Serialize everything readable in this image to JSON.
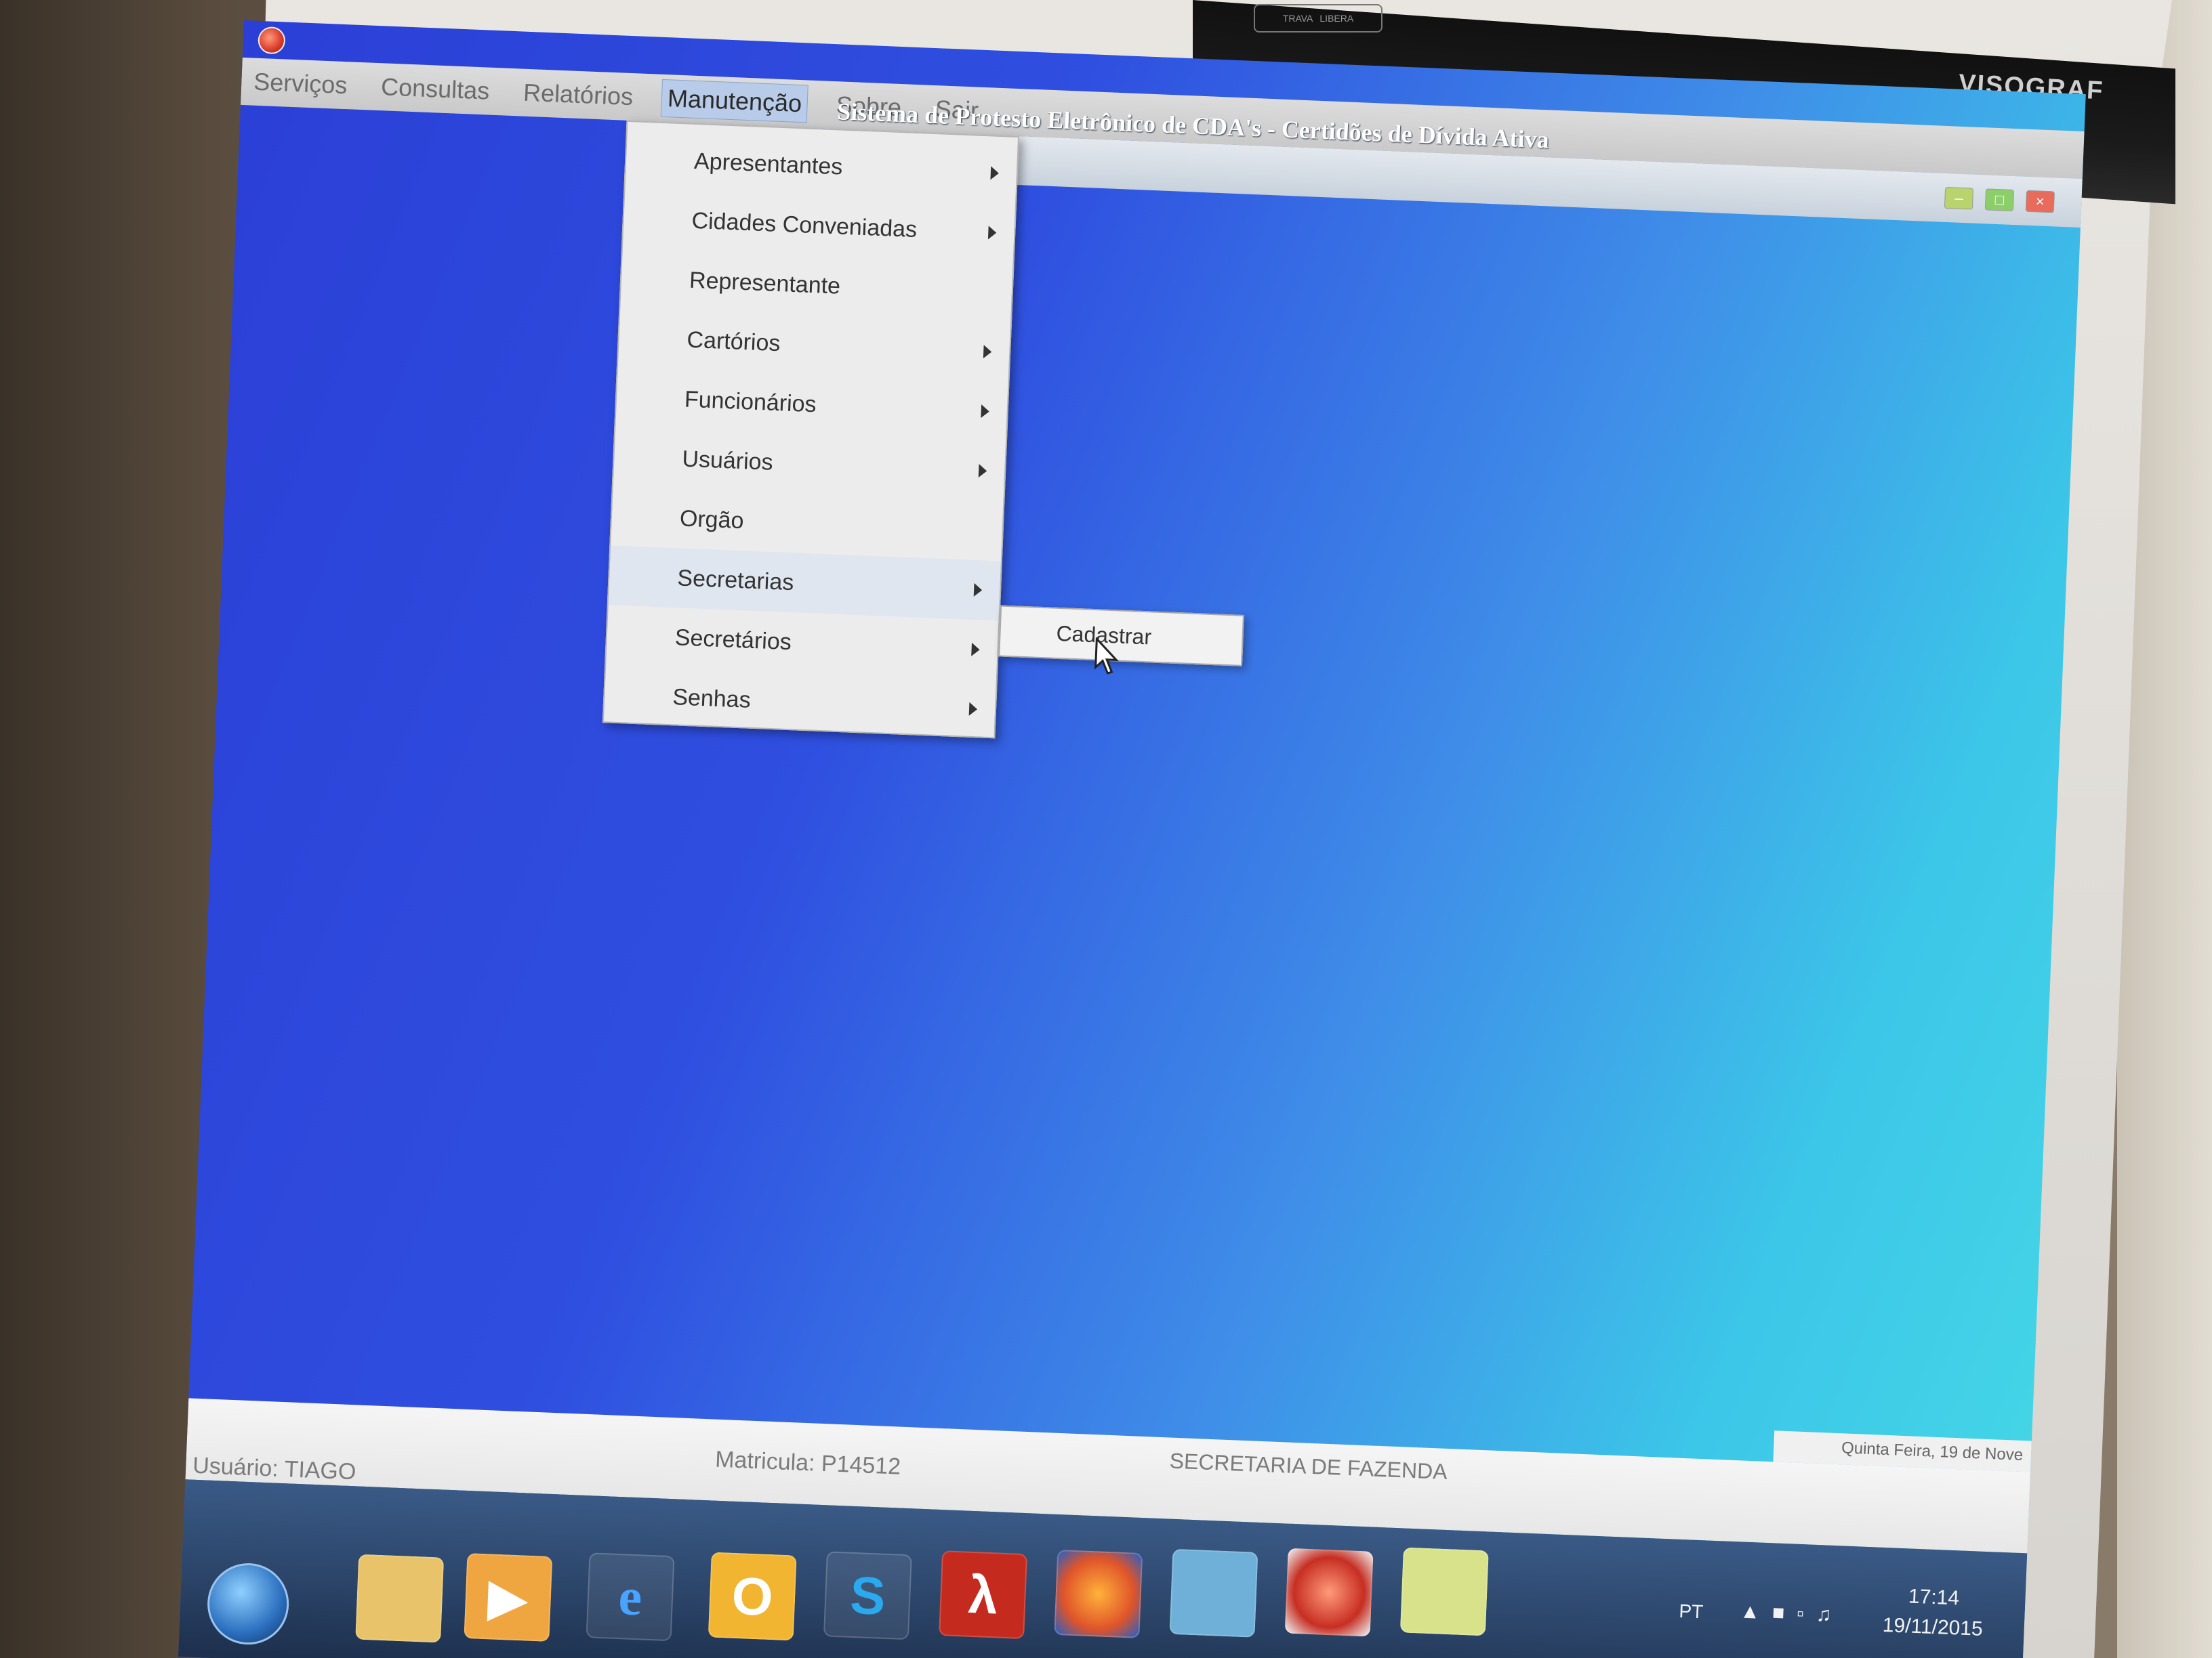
{
  "monitor_brand": "VISOGRAF",
  "top_plate": [
    "TRAVA",
    "LIBERA"
  ],
  "app": {
    "title": "Sistema de Protesto Eletrônico de CDA's - Certidões de Dívida Ativa"
  },
  "menubar": {
    "items": [
      "Serviços",
      "Consultas",
      "Relatórios",
      "Manutenção",
      "Sobre",
      "Sair"
    ],
    "active": "Manutenção"
  },
  "dropdown": {
    "items": [
      {
        "label": "Apresentantes",
        "has_submenu": true
      },
      {
        "label": "Cidades Conveniadas",
        "has_submenu": true
      },
      {
        "label": "Representante",
        "has_submenu": false
      },
      {
        "label": "Cartórios",
        "has_submenu": true
      },
      {
        "label": "Funcionários",
        "has_submenu": true
      },
      {
        "label": "Usuários",
        "has_submenu": true
      },
      {
        "label": "Orgão",
        "has_submenu": false
      },
      {
        "label": "Secretarias",
        "has_submenu": true
      },
      {
        "label": "Secretários",
        "has_submenu": true
      },
      {
        "label": "Senhas",
        "has_submenu": true
      }
    ],
    "highlighted": "Secretarias"
  },
  "submenu": {
    "items": [
      "Cadastrar"
    ]
  },
  "status": {
    "date_text": "Quinta Feira, 19 de Nove",
    "user": "Usuário: TIAGO",
    "matricula": "Matricula: P14512",
    "secretaria": "SECRETARIA DE FAZENDA"
  },
  "taskbar": {
    "icons": [
      "windows-explorer-folder",
      "media-player",
      "internet-explorer",
      "outlook",
      "skype",
      "adobe-reader",
      "firefox",
      "remote-desktop",
      "protesto-app",
      "sticky-notes"
    ],
    "language": "PT",
    "time": "17:14",
    "date": "19/11/2015"
  },
  "colors": {
    "desktop_start": "#2b3fd6",
    "desktop_end": "#46d9e6",
    "menu_bg": "#ececec",
    "taskbar": "#2b4468"
  }
}
